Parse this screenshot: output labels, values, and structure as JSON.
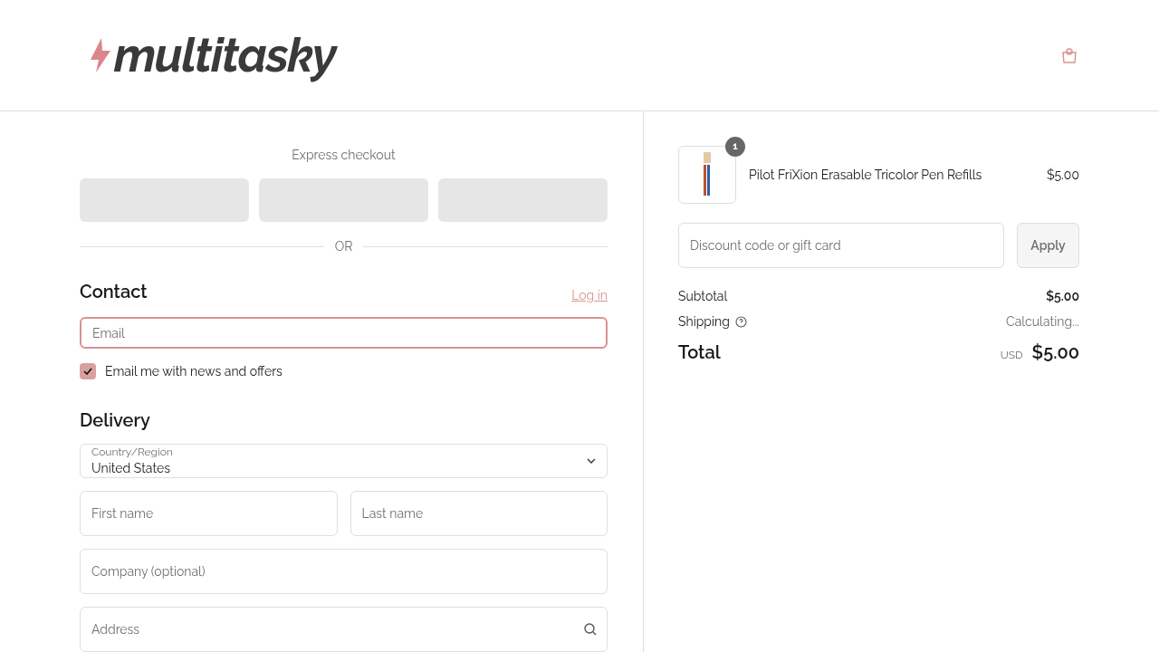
{
  "header": {
    "logo": "multitasky"
  },
  "express": {
    "label": "Express checkout",
    "divider": "OR"
  },
  "contact": {
    "title": "Contact",
    "login": "Log in",
    "email": {
      "placeholder": "Email",
      "focused": true
    },
    "newsletter": {
      "label": "Email me with news and offers",
      "checked": true
    }
  },
  "delivery": {
    "title": "Delivery",
    "country": {
      "label": "Country/Region",
      "value": "United States"
    },
    "fields": [
      {
        "kind": "pair",
        "items": [
          {
            "placeholder": "First name"
          },
          {
            "placeholder": "Last name"
          }
        ]
      },
      {
        "kind": "single",
        "placeholder": "Company (optional)"
      },
      {
        "kind": "search",
        "placeholder": "Address"
      }
    ]
  },
  "order": {
    "items": [
      {
        "name": "Pilot FriXion Erasable Tricolor Pen Refills",
        "price": "$5.00",
        "quantity": "1"
      }
    ],
    "discount": {
      "placeholder": "Discount code or gift card",
      "button": "Apply"
    },
    "subtotal": {
      "label": "Subtotal",
      "value": "$5.00"
    },
    "shipping": {
      "label": "Shipping",
      "value": "Calculating..."
    },
    "total": {
      "label": "Total",
      "currency": "USD",
      "value": "$5.00"
    }
  }
}
